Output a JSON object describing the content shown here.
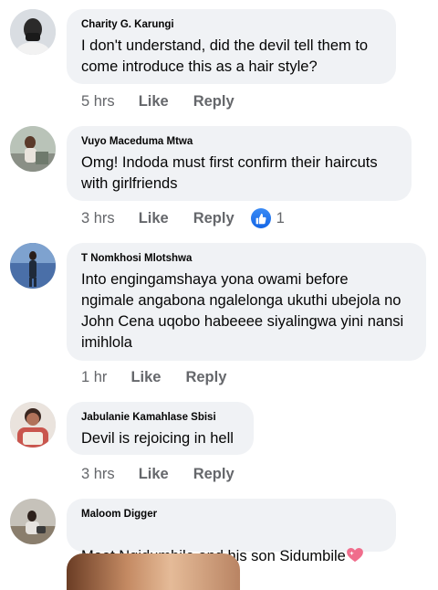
{
  "comments": [
    {
      "author": "Charity G. Karungi",
      "text": "I don't understand, did the devil tell them to\ncome introduce this as a hair style?",
      "time": "5 hrs",
      "like_label": "Like",
      "reply_label": "Reply"
    },
    {
      "author": "Vuyo Maceduma Mtwa",
      "text": "Omg! Indoda must first confirm their haircuts\nwith girlfriends",
      "time": "3 hrs",
      "like_label": "Like",
      "reply_label": "Reply",
      "reaction_count": "1"
    },
    {
      "author": "T Nomkhosi Mlotshwa",
      "text": "Into engingamshaya yona owami before\nngimale angabona ngalelonga ukuthi ubejola no\nJohn Cena uqobo habeeee siyalingwa yini nansi\nimihlola",
      "time": "1 hr",
      "like_label": "Like",
      "reply_label": "Reply"
    },
    {
      "author": "Jabulanie Kamahlase Sbisi",
      "text": "Devil is rejoicing in hell",
      "time": "3 hrs",
      "like_label": "Like",
      "reply_label": "Reply"
    },
    {
      "author": "Maloom Digger",
      "text": "Meet Ngidumbile and his son Sidumbile",
      "time": "",
      "like_label": "",
      "reply_label": ""
    }
  ],
  "icons": {
    "like_reaction": "thumbs-up-icon",
    "emoji": "sparkling-heart-icon"
  },
  "colors": {
    "bubble": "#f0f2f5",
    "meta_text": "#65676b",
    "like_blue": "#1877f2"
  }
}
